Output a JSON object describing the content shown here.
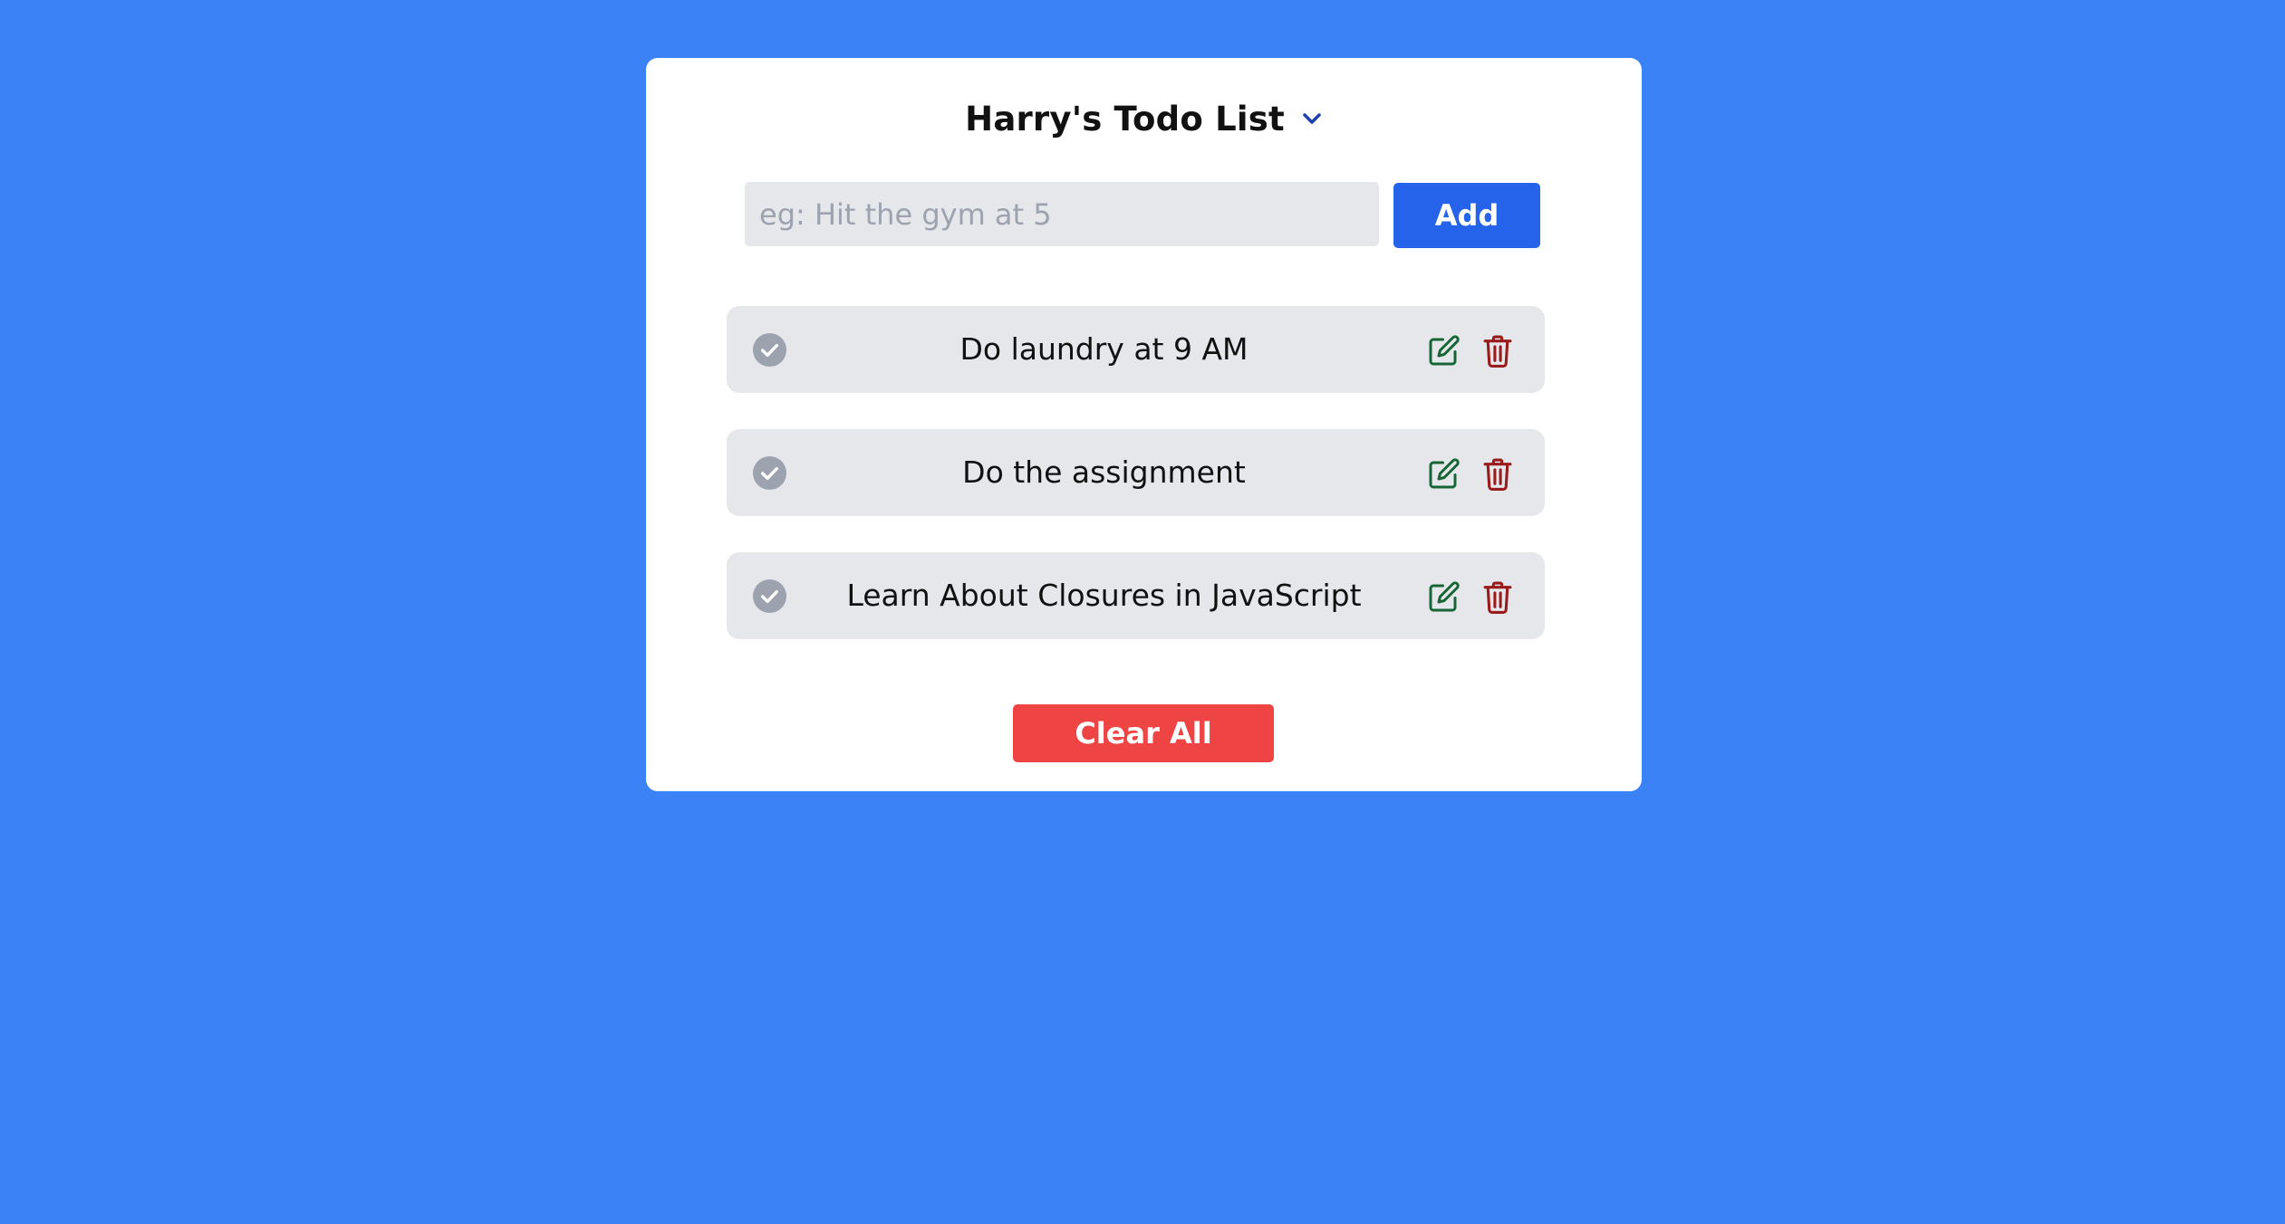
{
  "app": {
    "title": "Harry's Todo List",
    "chevron_icon": "chevron-down-icon"
  },
  "input": {
    "value": "",
    "placeholder": "eg: Hit the gym at 5"
  },
  "buttons": {
    "add_label": "Add",
    "clear_label": "Clear All"
  },
  "todos": [
    {
      "text": "Do laundry at 9 AM"
    },
    {
      "text": "Do the assignment"
    },
    {
      "text": "Learn About Closures in JavaScript"
    }
  ],
  "icons": {
    "check": "check-circle-icon",
    "edit": "edit-icon",
    "delete": "trash-icon"
  },
  "colors": {
    "background": "#3b82f6",
    "card": "#ffffff",
    "add_button": "#2563eb",
    "clear_button": "#ef4444",
    "item_background": "#e5e7eb",
    "check_icon": "#9ca3af",
    "edit_icon": "#166534",
    "delete_icon": "#991b1b",
    "chevron": "#1e40af"
  }
}
